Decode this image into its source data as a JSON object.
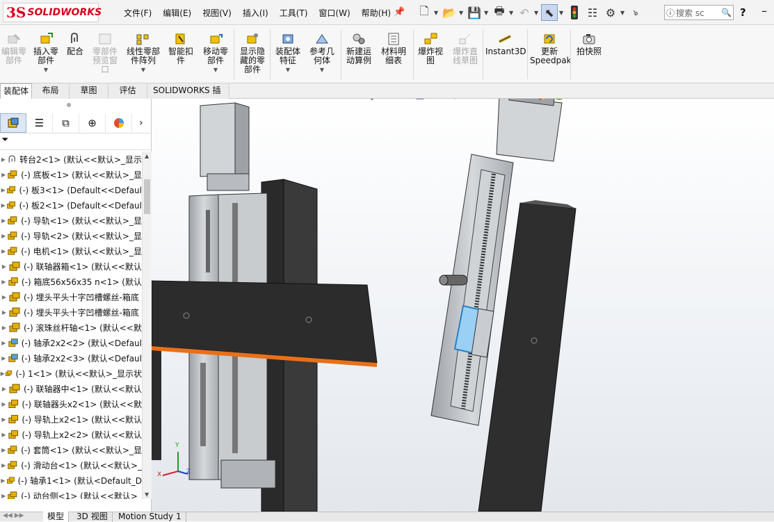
{
  "app": {
    "logo_prefix": "3S",
    "logo_text": "SOLIDWORKS"
  },
  "menus": [
    "文件(F)",
    "编辑(E)",
    "视图(V)",
    "插入(I)",
    "工具(T)",
    "窗口(W)",
    "帮助(H)"
  ],
  "search": {
    "placeholder": "搜索 sc"
  },
  "help_label": "?",
  "commands": [
    {
      "label": "编辑零\n部件",
      "icon": "edit-component-icon",
      "disabled": true
    },
    {
      "label": "插入零\n部件",
      "icon": "insert-component-icon",
      "disabled": false
    },
    {
      "label": "配合",
      "icon": "mate-icon",
      "disabled": false
    },
    {
      "label": "零部件\n预览窗\n口",
      "icon": "component-preview-icon",
      "disabled": true
    },
    {
      "label": "线性零部\n件阵列",
      "icon": "linear-pattern-icon",
      "disabled": false
    },
    {
      "label": "智能扣\n件",
      "icon": "smart-fasteners-icon",
      "disabled": false
    },
    {
      "label": "移动零\n部件",
      "icon": "move-component-icon",
      "disabled": false
    },
    {
      "label": "显示隐\n藏的零\n部件",
      "icon": "show-hidden-icon",
      "disabled": false
    },
    {
      "label": "装配体\n特征",
      "icon": "assembly-features-icon",
      "disabled": false
    },
    {
      "label": "参考几\n何体",
      "icon": "reference-geometry-icon",
      "disabled": false
    },
    {
      "label": "新建运\n动算例",
      "icon": "new-motion-study-icon",
      "disabled": false
    },
    {
      "label": "材料明\n细表",
      "icon": "bill-of-materials-icon",
      "disabled": false
    },
    {
      "label": "爆炸视\n图",
      "icon": "exploded-view-icon",
      "disabled": false
    },
    {
      "label": "爆炸直\n线草图",
      "icon": "explode-line-sketch-icon",
      "disabled": true
    },
    {
      "label": "Instant3D",
      "icon": "instant3d-icon",
      "disabled": false
    },
    {
      "label": "更新\nSpeedpak",
      "icon": "update-speedpak-icon",
      "disabled": false
    },
    {
      "label": "拍快照",
      "icon": "snapshot-icon",
      "disabled": false
    }
  ],
  "tabs": [
    "装配体",
    "布局",
    "草图",
    "评估",
    "SOLIDWORKS 插件"
  ],
  "tree": [
    {
      "label": "转台2<1> (默认<<默认>_显示",
      "icon": "mate-reference-icon"
    },
    {
      "label": "(-) 底板<1> (默认<<默认>_显",
      "icon": "part-icon"
    },
    {
      "label": "(-) 板3<1> (Default<<Defaul",
      "icon": "part-icon"
    },
    {
      "label": "(-) 板2<1> (Default<<Defaul",
      "icon": "part-icon"
    },
    {
      "label": "(-) 导轨<1> (默认<<默认>_显",
      "icon": "part-icon"
    },
    {
      "label": "(-) 导轨<2> (默认<<默认>_显",
      "icon": "part-icon"
    },
    {
      "label": "(-) 电机<1> (默认<<默认>_显",
      "icon": "part-icon"
    },
    {
      "label": "(-) 联轴器箱<1> (默认<<默认",
      "icon": "part-icon"
    },
    {
      "label": "(-) 箱底56x56x35 n<1> (默认",
      "icon": "part-icon"
    },
    {
      "label": "(-) 埋头平头十字凹槽螺丝-箱底",
      "icon": "part-icon"
    },
    {
      "label": "(-) 埋头平头十字凹槽螺丝-箱底",
      "icon": "part-icon"
    },
    {
      "label": "(-) 滚珠丝杆轴<1> (默认<<默",
      "icon": "part-icon"
    },
    {
      "label": "(-) 轴承2x2<2> (默认<Defaul",
      "icon": "part-blue-icon"
    },
    {
      "label": "(-) 轴承2x2<3> (默认<Defaul",
      "icon": "part-blue-icon"
    },
    {
      "label": "(-) 1<1> (默认<<默认>_显示状",
      "icon": "part-icon"
    },
    {
      "label": "(-) 联轴器中<1> (默认<<默认",
      "icon": "part-icon"
    },
    {
      "label": "(-) 联轴器头x2<1> (默认<<默",
      "icon": "part-icon"
    },
    {
      "label": "(-) 导轨上x2<1> (默认<<默认",
      "icon": "part-icon"
    },
    {
      "label": "(-) 导轨上x2<2> (默认<<默认",
      "icon": "part-icon"
    },
    {
      "label": "(-) 套筒<1> (默认<<默认>_显",
      "icon": "part-icon"
    },
    {
      "label": "(-) 滑动台<1> (默认<<默认>_",
      "icon": "part-icon"
    },
    {
      "label": "(-) 轴承1<1> (默认<Default_D",
      "icon": "part-icon"
    },
    {
      "label": "(-) 动台侧<1> (默认<<默认>_",
      "icon": "part-icon"
    }
  ],
  "bottom_tabs": [
    "模型",
    "3D 视图",
    "Motion Study 1"
  ],
  "triad": {
    "y": "Y",
    "x": "X",
    "z": "Z"
  },
  "colors": {
    "brand": "#d6001c",
    "edge_highlight": "#e8701a",
    "part_icon": "#e8b000",
    "selection": "#4aa3df"
  }
}
